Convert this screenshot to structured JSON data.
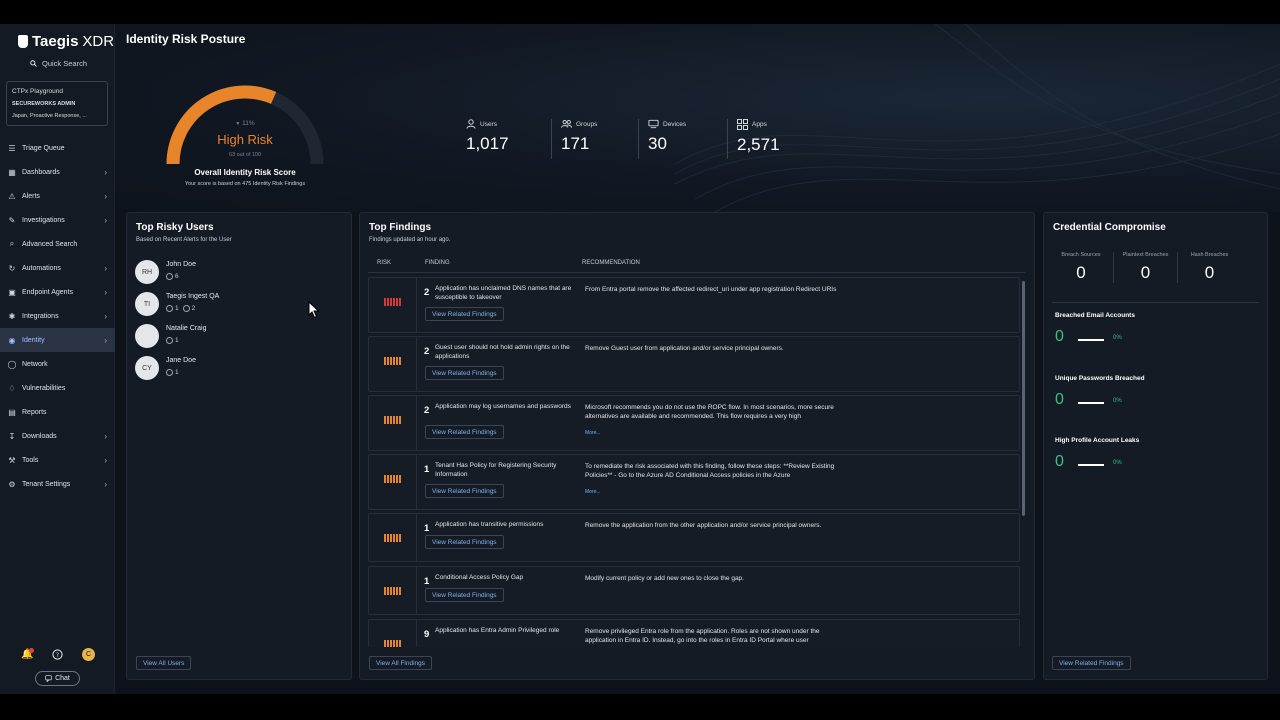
{
  "sidebar": {
    "logo_bold": "Taegis",
    "logo_light": "XDR",
    "quick_search": "Quick Search",
    "tenant": {
      "name": "CTPx Playground",
      "org": "SECUREWORKS ADMIN",
      "regions": "Japan, Proactive Response, ..."
    },
    "items": [
      {
        "label": "Triage Queue",
        "icon": "triage-icon",
        "chevron": false
      },
      {
        "label": "Dashboards",
        "icon": "dashboard-icon",
        "chevron": true
      },
      {
        "label": "Alerts",
        "icon": "alert-icon",
        "chevron": true
      },
      {
        "label": "Investigations",
        "icon": "investigation-icon",
        "chevron": true
      },
      {
        "label": "Advanced Search",
        "icon": "advanced-search-icon",
        "chevron": false
      },
      {
        "label": "Automations",
        "icon": "automation-icon",
        "chevron": true
      },
      {
        "label": "Endpoint Agents",
        "icon": "endpoint-icon",
        "chevron": true
      },
      {
        "label": "Integrations",
        "icon": "integration-icon",
        "chevron": true
      },
      {
        "label": "Identity",
        "icon": "identity-icon",
        "chevron": true,
        "active": true
      },
      {
        "label": "Network",
        "icon": "network-icon",
        "chevron": false
      },
      {
        "label": "Vulnerabilities",
        "icon": "vulnerability-icon",
        "chevron": false
      },
      {
        "label": "Reports",
        "icon": "report-icon",
        "chevron": false
      },
      {
        "label": "Downloads",
        "icon": "download-icon",
        "chevron": true
      },
      {
        "label": "Tools",
        "icon": "tools-icon",
        "chevron": true
      },
      {
        "label": "Tenant Settings",
        "icon": "settings-icon",
        "chevron": true
      }
    ],
    "avatar_initial": "C",
    "chat_label": "Chat"
  },
  "header": {
    "title": "Identity Risk Posture",
    "gauge": {
      "change": "11%",
      "label": "High Risk",
      "score_text": "63 out of 100",
      "score": 63,
      "max": 100,
      "title": "Overall Identity Risk Score",
      "note": "Your score is based on 475 Identity Risk Findings",
      "color": "#e8842a"
    },
    "stats": [
      {
        "label": "Users",
        "value": "1,017",
        "icon": "user-icon"
      },
      {
        "label": "Groups",
        "value": "171",
        "icon": "groups-icon"
      },
      {
        "label": "Devices",
        "value": "30",
        "icon": "device-icon"
      },
      {
        "label": "Apps",
        "value": "2,571",
        "icon": "apps-icon"
      }
    ]
  },
  "risky_users": {
    "title": "Top Risky Users",
    "subtitle": "Based on Recent Alerts for the User",
    "users": [
      {
        "initials": "RH",
        "name": "John Doe",
        "c1": "6",
        "c2": ""
      },
      {
        "initials": "TI",
        "name": "Taegis Ingest QA",
        "c1": "1",
        "c2": "2"
      },
      {
        "initials": "",
        "name": "Natalie Craig",
        "c1": "1",
        "c2": ""
      },
      {
        "initials": "CY",
        "name": "Jane Doe",
        "c1": "1",
        "c2": ""
      }
    ],
    "view_all": "View All Users"
  },
  "findings": {
    "title": "Top Findings",
    "subtitle": "Findings updated an hour ago.",
    "col_risk": "RISK",
    "col_finding": "FINDING",
    "col_recommendation": "RECOMMENDATION",
    "related_label": "View Related Findings",
    "more_label": "More...",
    "rows": [
      {
        "count": "2",
        "finding": "Application has unclaimed DNS names that are susceptible to takeover",
        "rec": "From Entra portal remove the affected redirect_uri under app registration Redirect URIs",
        "severity": "critical",
        "more": false
      },
      {
        "count": "2",
        "finding": "Guest user should not hold admin rights on the applications",
        "rec": "Remove Guest user from application and/or service principal owners.",
        "severity": "high",
        "more": false
      },
      {
        "count": "2",
        "finding": "Application may log usernames and passwords",
        "rec": "Microsoft recommends you do not use the ROPC flow. In most scenarios, more secure alternatives are available and recommended. This flow requires a very high",
        "severity": "high",
        "more": true
      },
      {
        "count": "1",
        "finding": "Tenant Has Policy for Registering Security Information",
        "rec": "To remediate the risk associated with this finding, follow these steps: **Review Existing Policies** - Go to the Azure AD Conditional Access policies in the Azure",
        "severity": "high",
        "more": true
      },
      {
        "count": "1",
        "finding": "Application has transitive permissions",
        "rec": "Remove the application from the other application and/or service principal owners.",
        "severity": "high",
        "more": false
      },
      {
        "count": "1",
        "finding": "Conditional Access Policy Gap",
        "rec": "Modify current policy or add new ones to close the gap.",
        "severity": "high",
        "more": false
      },
      {
        "count": "9",
        "finding": "Application has Entra Admin Privileged role",
        "rec": "Remove privileged Entra role from the application. Roles are not shown under the application in Entra ID. Instead, go into the roles in Entra ID Portal where user",
        "severity": "high",
        "more": false
      }
    ],
    "view_all": "View All Findings"
  },
  "credential": {
    "title": "Credential Compromise",
    "stats": [
      {
        "label": "Breach Sources",
        "value": "0"
      },
      {
        "label": "Plaintext Breaches",
        "value": "0"
      },
      {
        "label": "Hash Breaches",
        "value": "0"
      }
    ],
    "rows": [
      {
        "label": "Breached Email Accounts",
        "value": "0",
        "pct": "0%"
      },
      {
        "label": "Unique Passwords Breached",
        "value": "0",
        "pct": "0%"
      },
      {
        "label": "High Profile Account Leaks",
        "value": "0",
        "pct": "0%"
      }
    ],
    "related": "View Related Findings"
  }
}
